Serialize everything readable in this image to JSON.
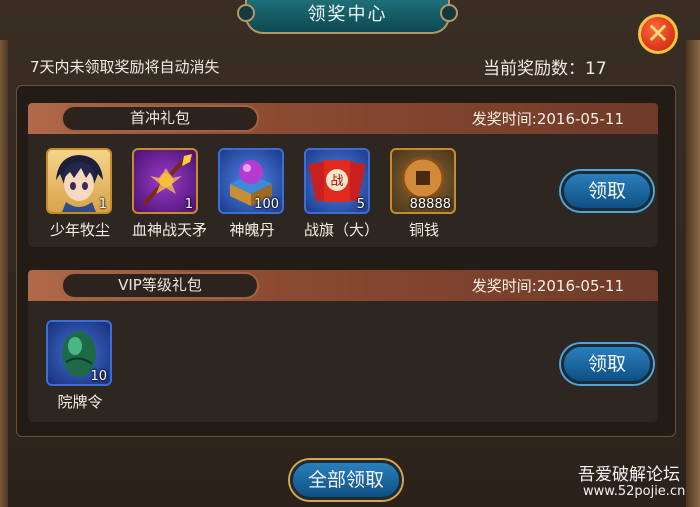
{
  "window": {
    "title": "领奖中心",
    "close_symbol": "✕"
  },
  "notice": "7天内未领取奖励将自动消失",
  "reward_count": {
    "label": "当前奖励数：",
    "value": "17"
  },
  "packs": [
    {
      "title": "首冲礼包",
      "date": "发奖时间:2016-05-11",
      "button": "领取",
      "items": [
        {
          "name": "少年牧尘",
          "qty": "1",
          "icon": "hero-portrait-icon"
        },
        {
          "name": "血神战天矛",
          "qty": "1",
          "icon": "spear-icon"
        },
        {
          "name": "神魄丹",
          "qty": "100",
          "icon": "treasure-chest-icon"
        },
        {
          "name": "战旗（大）",
          "qty": "5",
          "icon": "war-flag-icon"
        },
        {
          "name": "铜钱",
          "qty": "88888",
          "icon": "copper-coin-icon"
        }
      ]
    },
    {
      "title": "VIP等级礼包",
      "date": "发奖时间:2016-05-11",
      "button": "领取",
      "items": [
        {
          "name": "院牌令",
          "qty": "10",
          "icon": "green-egg-token-icon"
        }
      ]
    }
  ],
  "claim_all": "全部领取",
  "watermark": {
    "line1": "吾爱破解论坛",
    "line2": "www.52pojie.cn"
  },
  "colors": {
    "accent_blue": "#1f6fa8",
    "ribbon": "#a35d3e",
    "gold_border": "#c78b2c",
    "close_red": "#d42a10"
  }
}
